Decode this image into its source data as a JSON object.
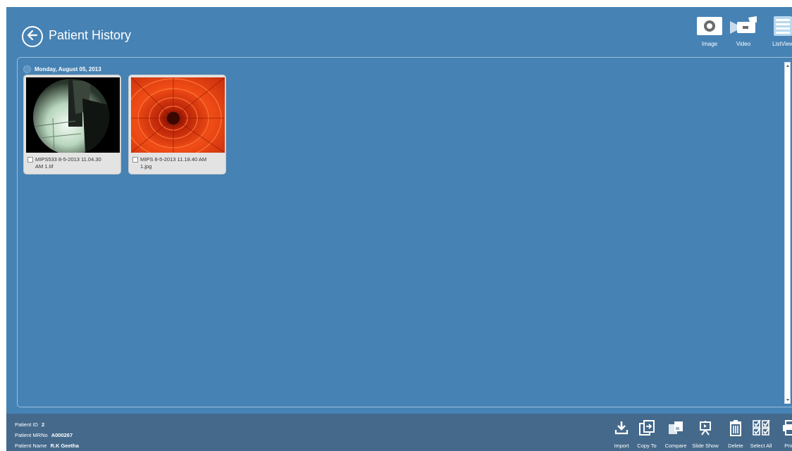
{
  "header": {
    "title": "Patient History",
    "view_buttons": [
      {
        "label": "Image",
        "icon": "camera-icon"
      },
      {
        "label": "Video",
        "icon": "video-camera-icon"
      },
      {
        "label": "ListView",
        "icon": "list-view-icon"
      }
    ]
  },
  "gallery": {
    "group_date": "Monday, August 05, 2013",
    "items": [
      {
        "caption": "MIPS533 8-5-2013 11.04.30\nAM 1.tif",
        "image": "endoscope-view-image"
      },
      {
        "caption": "MIPS 8-5-2013 11.18.40 AM\n1.jpg",
        "image": "red-flower-image"
      }
    ]
  },
  "footer": {
    "patient_id_label": "Patient ID",
    "patient_id": "2",
    "patient_mrno_label": "Patient MRNo",
    "patient_mrno": "A000267",
    "patient_name_label": "Patient Name",
    "patient_name": "R.K Geetha",
    "actions": [
      {
        "label": "Import",
        "icon": "import-icon"
      },
      {
        "label": "Copy To",
        "icon": "copy-to-icon"
      },
      {
        "label": "Compare",
        "icon": "compare-icon"
      },
      {
        "label": "Slide Show",
        "icon": "slide-show-icon"
      },
      {
        "label": "Delete",
        "icon": "trash-icon"
      },
      {
        "label": "Select All",
        "icon": "select-all-icon"
      },
      {
        "label": "Print",
        "icon": "printer-icon"
      }
    ]
  },
  "colors": {
    "background": "#4682b4",
    "footer": "#44698b",
    "thumbnail_card": "#e3e3e3"
  }
}
